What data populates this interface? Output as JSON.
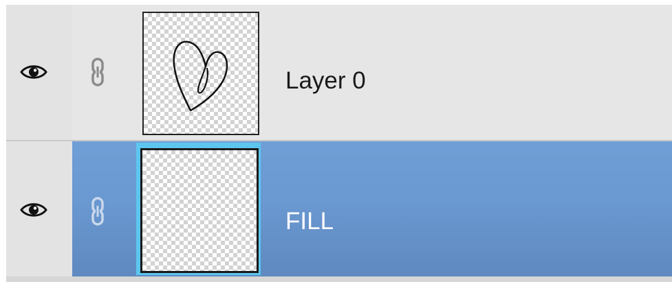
{
  "layers": [
    {
      "name": "Layer 0",
      "visible": true,
      "selected": false,
      "icons": [
        "eye-icon",
        "link-icon"
      ],
      "thumbnail": "heart-sketch"
    },
    {
      "name": "FILL",
      "visible": true,
      "selected": true,
      "icons": [
        "eye-icon",
        "link-icon"
      ],
      "thumbnail": "transparent"
    }
  ],
  "colors": {
    "selected_row": "#6a98d0",
    "selected_thumb_border": "#5cc6ee",
    "row_background": "#e3e3e3"
  }
}
